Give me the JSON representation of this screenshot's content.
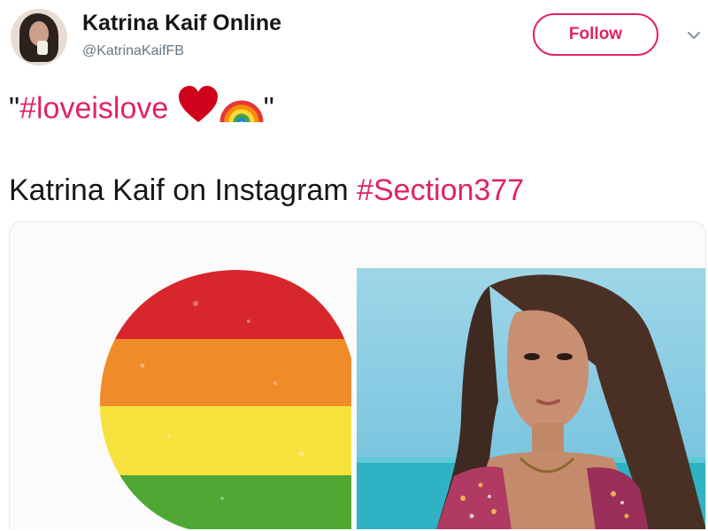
{
  "user": {
    "display_name": "Katrina Kaif Online",
    "handle": "@KatrinaKaifFB"
  },
  "actions": {
    "follow_label": "Follow"
  },
  "tweet": {
    "quote_open": "\"",
    "hashtag": "#loveislove",
    "quote_close": "\"",
    "emoji_icons": [
      "heart-icon",
      "rainbow-icon"
    ]
  },
  "card": {
    "title_text": "Katrina Kaif on Instagram ",
    "title_hashtag": "#Section377"
  },
  "colors": {
    "accent": "#e0245e",
    "text": "#14171a",
    "secondary": "#657786",
    "border": "#e1e8ed"
  },
  "pride_flag_colors": [
    "#d8262d",
    "#f08b2a",
    "#f7e23d",
    "#4ea833"
  ]
}
